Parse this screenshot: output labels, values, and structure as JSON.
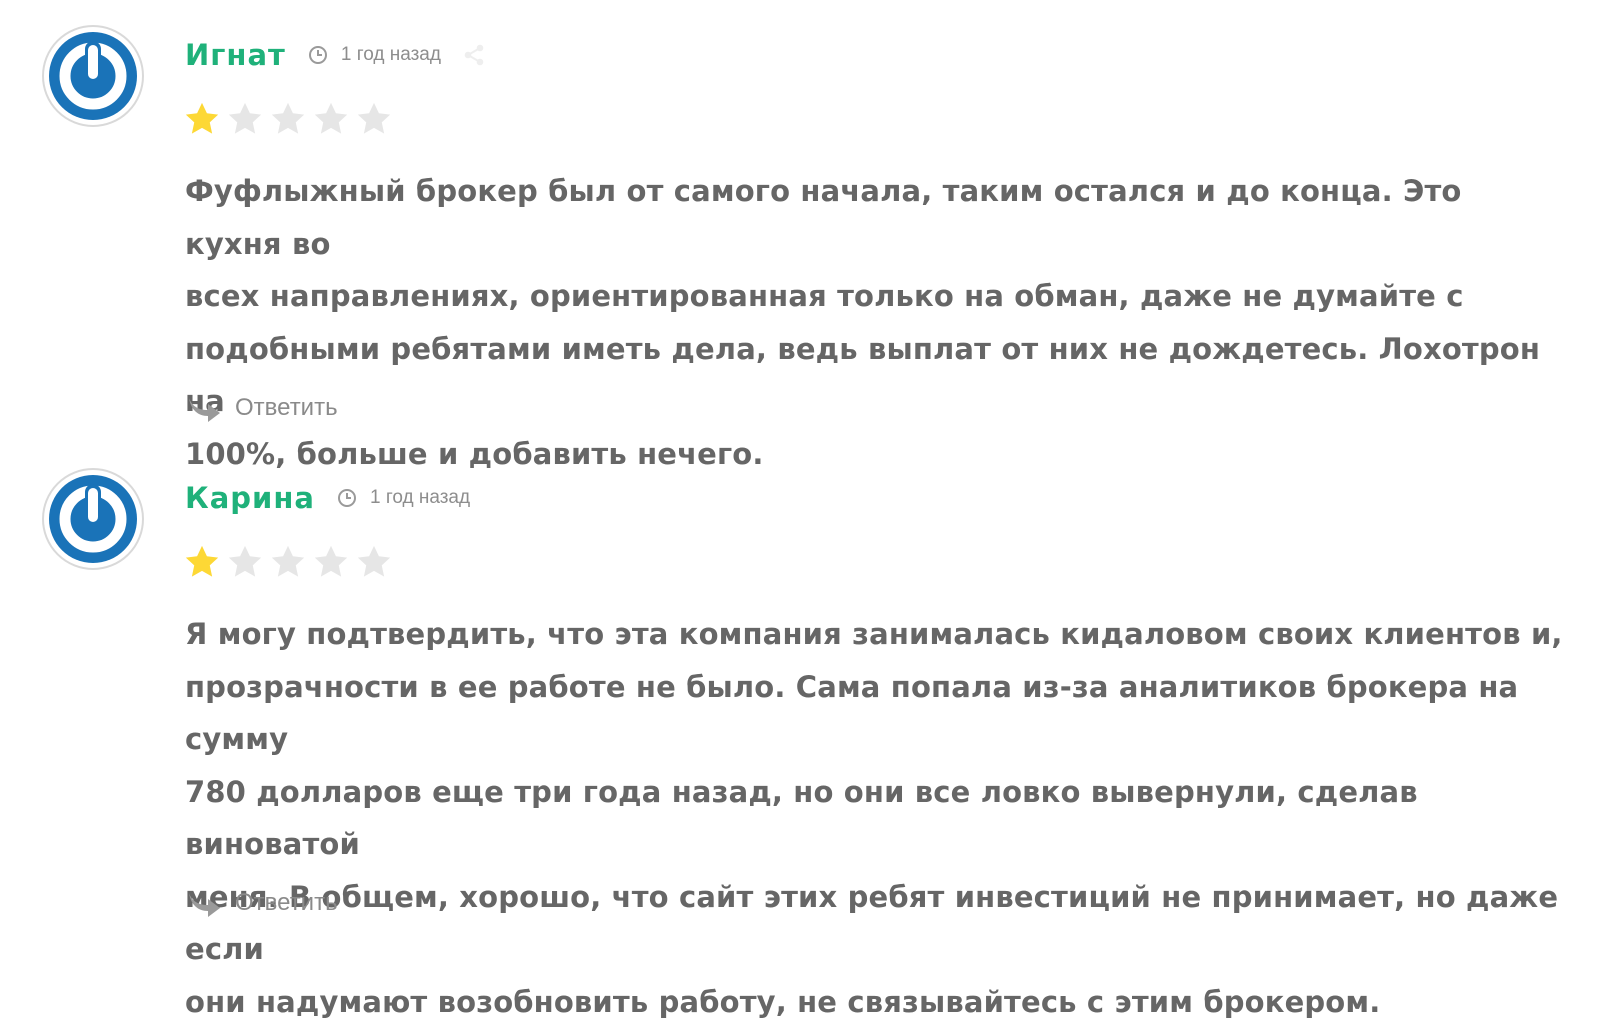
{
  "colors": {
    "author": "#1fb17a",
    "text": "#666666",
    "meta": "#8d8d8d",
    "star_filled": "#fdd835",
    "star_empty": "#e6e6e6",
    "avatar_blue": "#1a73b8"
  },
  "comments": [
    {
      "author": "Игнат",
      "time": "1 год назад",
      "rating": 1,
      "max_rating": 5,
      "text_lines": [
        "Фуфлыжный брокер был от самого начала, таким остался и до конца. Это кухня во",
        "всех направлениях, ориентированная только на обман, даже не думайте с",
        "подобными ребятами иметь дела, ведь выплат от них не дождетесь. Лохотрон на",
        "100%, больше и добавить нечего."
      ],
      "reply_label": "Ответить",
      "icons": {
        "avatar": "power-logo-avatar",
        "time": "clock-icon",
        "share": "share-icon",
        "reply": "reply-arrow-icon"
      }
    },
    {
      "author": "Карина",
      "time": "1 год назад",
      "rating": 1,
      "max_rating": 5,
      "text_lines": [
        "Я могу подтвердить, что эта компания занималась кидаловом своих клиентов и,",
        "прозрачности в ее работе не было. Сама попала из-за аналитиков брокера на сумму",
        "780 долларов еще три года назад, но они все ловко вывернули, сделав виноватой",
        "меня. В общем, хорошо, что сайт этих ребят инвестиций не принимает, но даже если",
        "они надумают возобновить работу, не связывайтесь с этим брокером."
      ],
      "reply_label": "Ответить",
      "icons": {
        "avatar": "power-logo-avatar",
        "time": "clock-icon",
        "reply": "reply-arrow-icon"
      }
    }
  ]
}
